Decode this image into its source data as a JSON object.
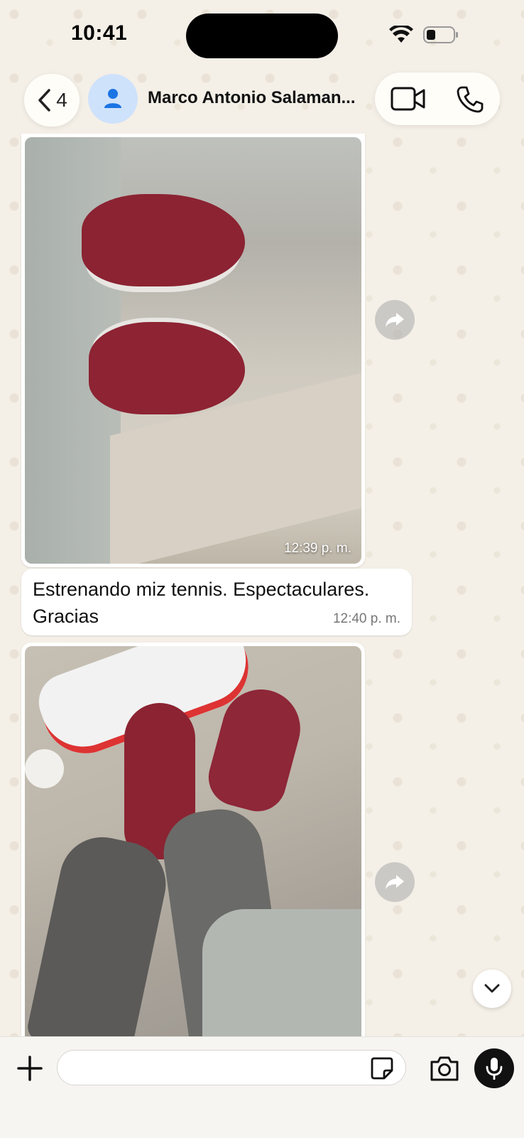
{
  "status_bar": {
    "time": "10:41"
  },
  "header": {
    "back_count": "4",
    "contact_name": "Marco Antonio Salaman..."
  },
  "messages": [
    {
      "type": "image",
      "time": "12:39 p. m.",
      "description": "red sneakers on carpet"
    },
    {
      "type": "text",
      "text": "Estrenando miz tennis. Espectaculares. Gracias",
      "time": "12:40 p. m."
    },
    {
      "type": "image",
      "description": "red sneakers next to white sneakers and grey shoes"
    }
  ],
  "icons": {
    "back": "chevron-left-icon",
    "avatar": "person-icon",
    "video": "video-camera-icon",
    "phone": "phone-icon",
    "forward": "forward-arrow-icon",
    "scroll": "chevron-down-icon",
    "plus": "plus-icon",
    "sticker": "sticker-icon",
    "camera": "camera-icon",
    "mic": "microphone-icon"
  },
  "colors": {
    "accent_avatar": "#cfe2fb",
    "avatar_icon": "#1b74e4",
    "bubble": "#ffffff",
    "mic_bg": "#111111"
  }
}
